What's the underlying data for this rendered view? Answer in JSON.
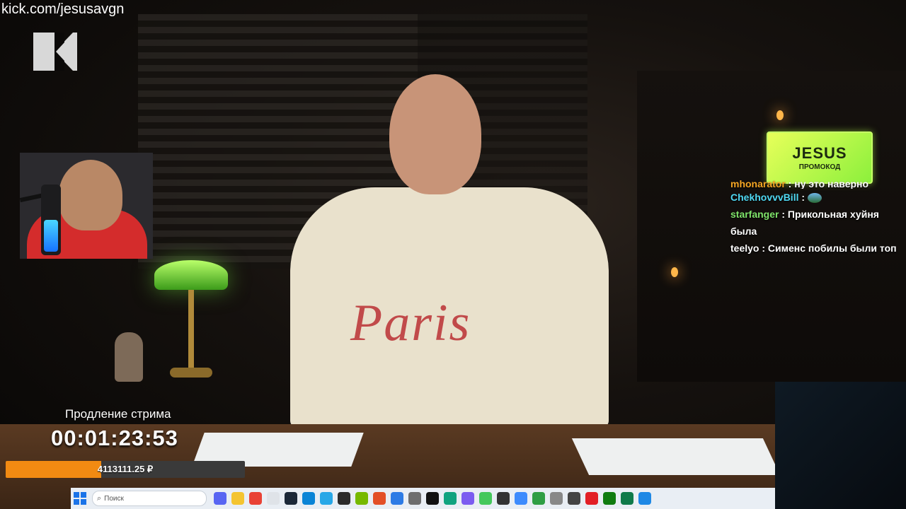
{
  "overlay": {
    "channel_url": "kick.com/jesusavgn"
  },
  "promo": {
    "code": "JESUS",
    "label": "ПРОМОКОД"
  },
  "chat": {
    "messages": [
      {
        "user": "mhonarator",
        "text": "ну это наверно",
        "user_color": "#f5a623"
      },
      {
        "user": "ChekhovvvBill",
        "text": "",
        "user_color": "#4fd8f2",
        "emote": "emote-icon"
      },
      {
        "user": "starfanger",
        "text": "Прикольная хуйня была",
        "user_color": "#7fe36a"
      },
      {
        "user": "teelyo",
        "text": "Сименс побилы были топ",
        "user_color": "#ffffff"
      }
    ]
  },
  "stream_timer": {
    "title": "Продление стрима",
    "time": "00:01:23:53"
  },
  "donation_bar": {
    "amount": "4113111.25 ₽",
    "fill_fraction": 0.4,
    "color": "#f28a12"
  },
  "shirt_text": "Paris",
  "taskbar": {
    "search_placeholder": "Поиск",
    "icons": [
      "windows-start-icon",
      "search-icon",
      "widgets-icon",
      "taskview-icon",
      "discord-icon",
      "file-explorer-icon",
      "chrome-icon",
      "notepad-icon",
      "steam-icon",
      "edge-icon",
      "telegram-icon",
      "terminal-icon",
      "nvidia-icon",
      "adobe-icon",
      "mail-icon",
      "settings-icon",
      "capcut-icon",
      "chatgpt-icon",
      "browser-icon",
      "nvidia-broadcast-icon",
      "obs-icon",
      "app-icon",
      "files-icon",
      "globe-icon",
      "network-icon",
      "record-icon",
      "xbox-icon",
      "game-icon",
      "photos-icon"
    ]
  }
}
